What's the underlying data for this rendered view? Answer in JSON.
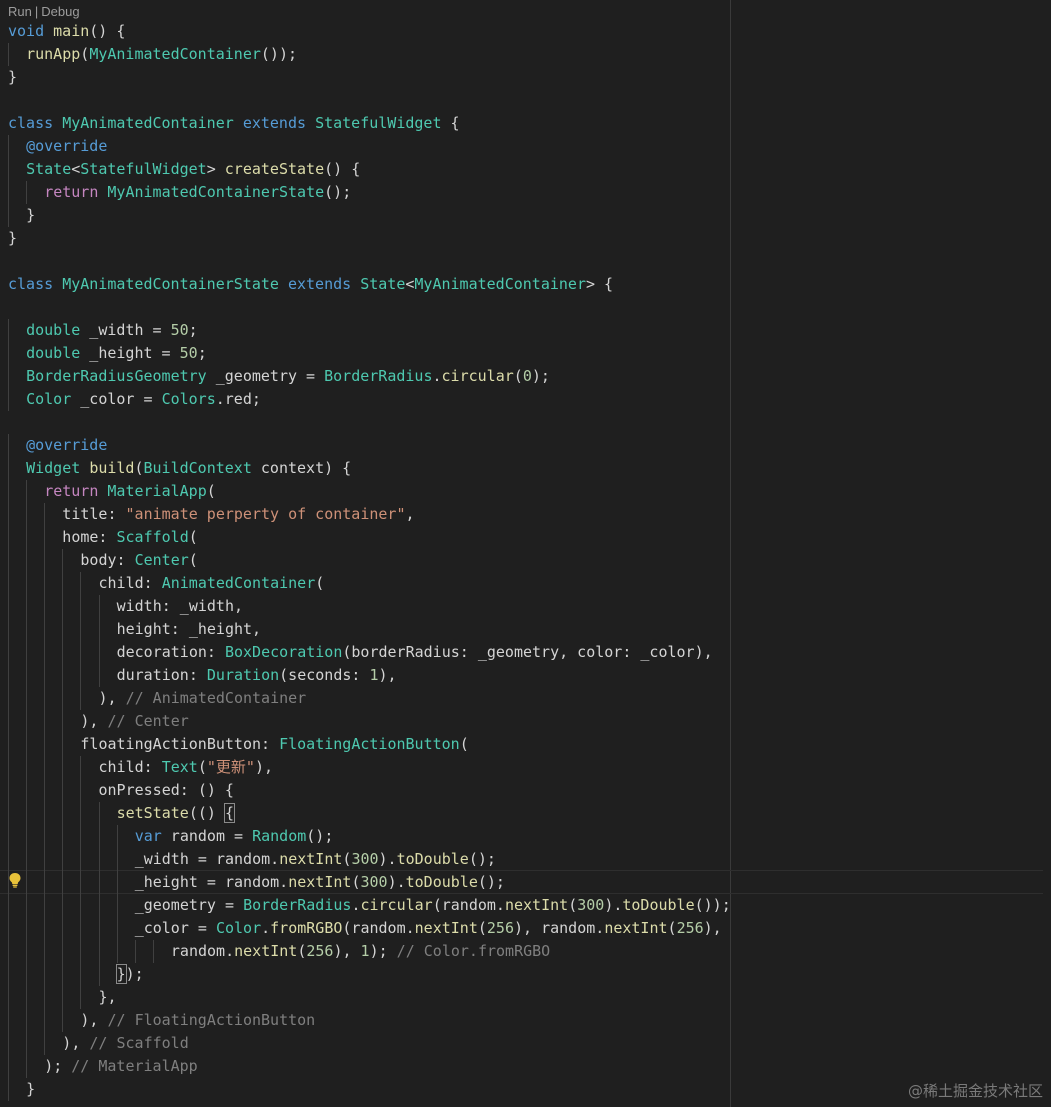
{
  "codelens": {
    "run": "Run",
    "separator": "|",
    "debug": "Debug"
  },
  "watermark": "@稀土掘金技术社区",
  "theme": {
    "background": "#1f1f1f",
    "keyword": "#569cd6",
    "control": "#c586c0",
    "type": "#4ec9b0",
    "function": "#dcdcaa",
    "number": "#b5cea8",
    "string": "#ce9178",
    "comment": "#7f7f7f"
  },
  "gutter_icons": [
    "lightbulb-icon"
  ],
  "code": [
    {
      "indent": 0,
      "tokens": [
        [
          "kw",
          "void"
        ],
        [
          "pun",
          " "
        ],
        [
          "fn",
          "main"
        ],
        [
          "pun",
          "() {"
        ]
      ]
    },
    {
      "indent": 1,
      "tokens": [
        [
          "fn",
          "runApp"
        ],
        [
          "pun",
          "("
        ],
        [
          "typ",
          "MyAnimatedContainer"
        ],
        [
          "pun",
          "());"
        ]
      ]
    },
    {
      "indent": 0,
      "tokens": [
        [
          "pun",
          "}"
        ]
      ]
    },
    {
      "indent": 0,
      "tokens": []
    },
    {
      "indent": 0,
      "tokens": [
        [
          "kw",
          "class"
        ],
        [
          "pun",
          " "
        ],
        [
          "typ",
          "MyAnimatedContainer"
        ],
        [
          "pun",
          " "
        ],
        [
          "kw",
          "extends"
        ],
        [
          "pun",
          " "
        ],
        [
          "typ",
          "StatefulWidget"
        ],
        [
          "pun",
          " {"
        ]
      ]
    },
    {
      "indent": 1,
      "tokens": [
        [
          "ann",
          "@override"
        ]
      ]
    },
    {
      "indent": 1,
      "tokens": [
        [
          "typ",
          "State"
        ],
        [
          "pun",
          "<"
        ],
        [
          "typ",
          "StatefulWidget"
        ],
        [
          "pun",
          "> "
        ],
        [
          "fn",
          "createState"
        ],
        [
          "pun",
          "() {"
        ]
      ]
    },
    {
      "indent": 2,
      "tokens": [
        [
          "ctl",
          "return"
        ],
        [
          "pun",
          " "
        ],
        [
          "typ",
          "MyAnimatedContainerState"
        ],
        [
          "pun",
          "();"
        ]
      ]
    },
    {
      "indent": 1,
      "tokens": [
        [
          "pun",
          "}"
        ]
      ]
    },
    {
      "indent": 0,
      "tokens": [
        [
          "pun",
          "}"
        ]
      ]
    },
    {
      "indent": 0,
      "tokens": []
    },
    {
      "indent": 0,
      "tokens": [
        [
          "kw",
          "class"
        ],
        [
          "pun",
          " "
        ],
        [
          "typ",
          "MyAnimatedContainerState"
        ],
        [
          "pun",
          " "
        ],
        [
          "kw",
          "extends"
        ],
        [
          "pun",
          " "
        ],
        [
          "typ",
          "State"
        ],
        [
          "pun",
          "<"
        ],
        [
          "typ",
          "MyAnimatedContainer"
        ],
        [
          "pun",
          "> {"
        ]
      ]
    },
    {
      "indent": 0,
      "tokens": []
    },
    {
      "indent": 1,
      "tokens": [
        [
          "typ",
          "double"
        ],
        [
          "pun",
          " _width = "
        ],
        [
          "num",
          "50"
        ],
        [
          "pun",
          ";"
        ]
      ]
    },
    {
      "indent": 1,
      "tokens": [
        [
          "typ",
          "double"
        ],
        [
          "pun",
          " _height = "
        ],
        [
          "num",
          "50"
        ],
        [
          "pun",
          ";"
        ]
      ]
    },
    {
      "indent": 1,
      "tokens": [
        [
          "typ",
          "BorderRadiusGeometry"
        ],
        [
          "pun",
          " _geometry = "
        ],
        [
          "typ",
          "BorderRadius"
        ],
        [
          "pun",
          "."
        ],
        [
          "fn",
          "circular"
        ],
        [
          "pun",
          "("
        ],
        [
          "num",
          "0"
        ],
        [
          "pun",
          ");"
        ]
      ]
    },
    {
      "indent": 1,
      "tokens": [
        [
          "typ",
          "Color"
        ],
        [
          "pun",
          " _color = "
        ],
        [
          "typ",
          "Colors"
        ],
        [
          "pun",
          ".red;"
        ]
      ]
    },
    {
      "indent": 0,
      "tokens": []
    },
    {
      "indent": 1,
      "tokens": [
        [
          "ann",
          "@override"
        ]
      ]
    },
    {
      "indent": 1,
      "tokens": [
        [
          "typ",
          "Widget"
        ],
        [
          "pun",
          " "
        ],
        [
          "fn",
          "build"
        ],
        [
          "pun",
          "("
        ],
        [
          "typ",
          "BuildContext"
        ],
        [
          "pun",
          " context) {"
        ]
      ]
    },
    {
      "indent": 2,
      "tokens": [
        [
          "ctl",
          "return"
        ],
        [
          "pun",
          " "
        ],
        [
          "typ",
          "MaterialApp"
        ],
        [
          "pun",
          "("
        ]
      ]
    },
    {
      "indent": 3,
      "tokens": [
        [
          "pun",
          "title: "
        ],
        [
          "str",
          "\"animate perperty of container\""
        ],
        [
          "pun",
          ","
        ]
      ]
    },
    {
      "indent": 3,
      "tokens": [
        [
          "pun",
          "home: "
        ],
        [
          "typ",
          "Scaffold"
        ],
        [
          "pun",
          "("
        ]
      ]
    },
    {
      "indent": 4,
      "tokens": [
        [
          "pun",
          "body: "
        ],
        [
          "typ",
          "Center"
        ],
        [
          "pun",
          "("
        ]
      ]
    },
    {
      "indent": 5,
      "tokens": [
        [
          "pun",
          "child: "
        ],
        [
          "typ",
          "AnimatedContainer"
        ],
        [
          "pun",
          "("
        ]
      ]
    },
    {
      "indent": 6,
      "tokens": [
        [
          "pun",
          "width: _width,"
        ]
      ]
    },
    {
      "indent": 6,
      "tokens": [
        [
          "pun",
          "height: _height,"
        ]
      ]
    },
    {
      "indent": 6,
      "tokens": [
        [
          "pun",
          "decoration: "
        ],
        [
          "typ",
          "BoxDecoration"
        ],
        [
          "pun",
          "(borderRadius: _geometry, color: _color),"
        ]
      ]
    },
    {
      "indent": 6,
      "tokens": [
        [
          "pun",
          "duration: "
        ],
        [
          "typ",
          "Duration"
        ],
        [
          "pun",
          "(seconds: "
        ],
        [
          "num",
          "1"
        ],
        [
          "pun",
          "),"
        ]
      ]
    },
    {
      "indent": 5,
      "tokens": [
        [
          "pun",
          "), "
        ],
        [
          "cmg",
          "// AnimatedContainer"
        ]
      ]
    },
    {
      "indent": 4,
      "tokens": [
        [
          "pun",
          "), "
        ],
        [
          "cmg",
          "// Center"
        ]
      ]
    },
    {
      "indent": 4,
      "tokens": [
        [
          "pun",
          "floatingActionButton: "
        ],
        [
          "typ",
          "FloatingActionButton"
        ],
        [
          "pun",
          "("
        ]
      ]
    },
    {
      "indent": 5,
      "tokens": [
        [
          "pun",
          "child: "
        ],
        [
          "typ",
          "Text"
        ],
        [
          "pun",
          "("
        ],
        [
          "str",
          "\"更新\""
        ],
        [
          "pun",
          "),"
        ]
      ]
    },
    {
      "indent": 5,
      "tokens": [
        [
          "pun",
          "onPressed: () {"
        ]
      ]
    },
    {
      "indent": 6,
      "tokens": [
        [
          "fn",
          "setState"
        ],
        [
          "pun",
          "(() "
        ],
        [
          "br",
          "{"
        ]
      ]
    },
    {
      "indent": 7,
      "tokens": [
        [
          "kw",
          "var"
        ],
        [
          "pun",
          " random = "
        ],
        [
          "typ",
          "Random"
        ],
        [
          "pun",
          "();"
        ]
      ]
    },
    {
      "indent": 7,
      "tokens": [
        [
          "pun",
          "_width = random."
        ],
        [
          "fn",
          "nextInt"
        ],
        [
          "pun",
          "("
        ],
        [
          "num",
          "300"
        ],
        [
          "pun",
          ")."
        ],
        [
          "fn",
          "toDouble"
        ],
        [
          "pun",
          "();"
        ]
      ]
    },
    {
      "indent": 7,
      "tokens": [
        [
          "pun",
          "_height = random."
        ],
        [
          "fn",
          "nextInt"
        ],
        [
          "pun",
          "("
        ],
        [
          "num",
          "300"
        ],
        [
          "pun",
          ")."
        ],
        [
          "fn",
          "toDouble"
        ],
        [
          "pun",
          "();"
        ]
      ]
    },
    {
      "indent": 7,
      "tokens": [
        [
          "pun",
          "_geometry = "
        ],
        [
          "typ",
          "BorderRadius"
        ],
        [
          "pun",
          "."
        ],
        [
          "fn",
          "circular"
        ],
        [
          "pun",
          "(random."
        ],
        [
          "fn",
          "nextInt"
        ],
        [
          "pun",
          "("
        ],
        [
          "num",
          "300"
        ],
        [
          "pun",
          ")."
        ],
        [
          "fn",
          "toDouble"
        ],
        [
          "pun",
          "());"
        ]
      ]
    },
    {
      "indent": 7,
      "tokens": [
        [
          "pun",
          "_color = "
        ],
        [
          "typ",
          "Color"
        ],
        [
          "pun",
          "."
        ],
        [
          "fn",
          "fromRGBO"
        ],
        [
          "pun",
          "(random."
        ],
        [
          "fn",
          "nextInt"
        ],
        [
          "pun",
          "("
        ],
        [
          "num",
          "256"
        ],
        [
          "pun",
          "), random."
        ],
        [
          "fn",
          "nextInt"
        ],
        [
          "pun",
          "("
        ],
        [
          "num",
          "256"
        ],
        [
          "pun",
          "),"
        ]
      ]
    },
    {
      "indent": 9,
      "tokens": [
        [
          "pun",
          "random."
        ],
        [
          "fn",
          "nextInt"
        ],
        [
          "pun",
          "("
        ],
        [
          "num",
          "256"
        ],
        [
          "pun",
          "), "
        ],
        [
          "num",
          "1"
        ],
        [
          "pun",
          "); "
        ],
        [
          "cmg",
          "// Color.fromRGBO"
        ]
      ]
    },
    {
      "indent": 6,
      "tokens": [
        [
          "br",
          "}"
        ],
        [
          "pun",
          ");"
        ]
      ]
    },
    {
      "indent": 5,
      "tokens": [
        [
          "pun",
          "},"
        ]
      ]
    },
    {
      "indent": 4,
      "tokens": [
        [
          "pun",
          "), "
        ],
        [
          "cmg",
          "// FloatingActionButton"
        ]
      ]
    },
    {
      "indent": 3,
      "tokens": [
        [
          "pun",
          "), "
        ],
        [
          "cmg",
          "// Scaffold"
        ]
      ]
    },
    {
      "indent": 2,
      "tokens": [
        [
          "pun",
          "); "
        ],
        [
          "cmg",
          "// MaterialApp"
        ]
      ]
    },
    {
      "indent": 1,
      "tokens": [
        [
          "pun",
          "}"
        ]
      ]
    }
  ]
}
